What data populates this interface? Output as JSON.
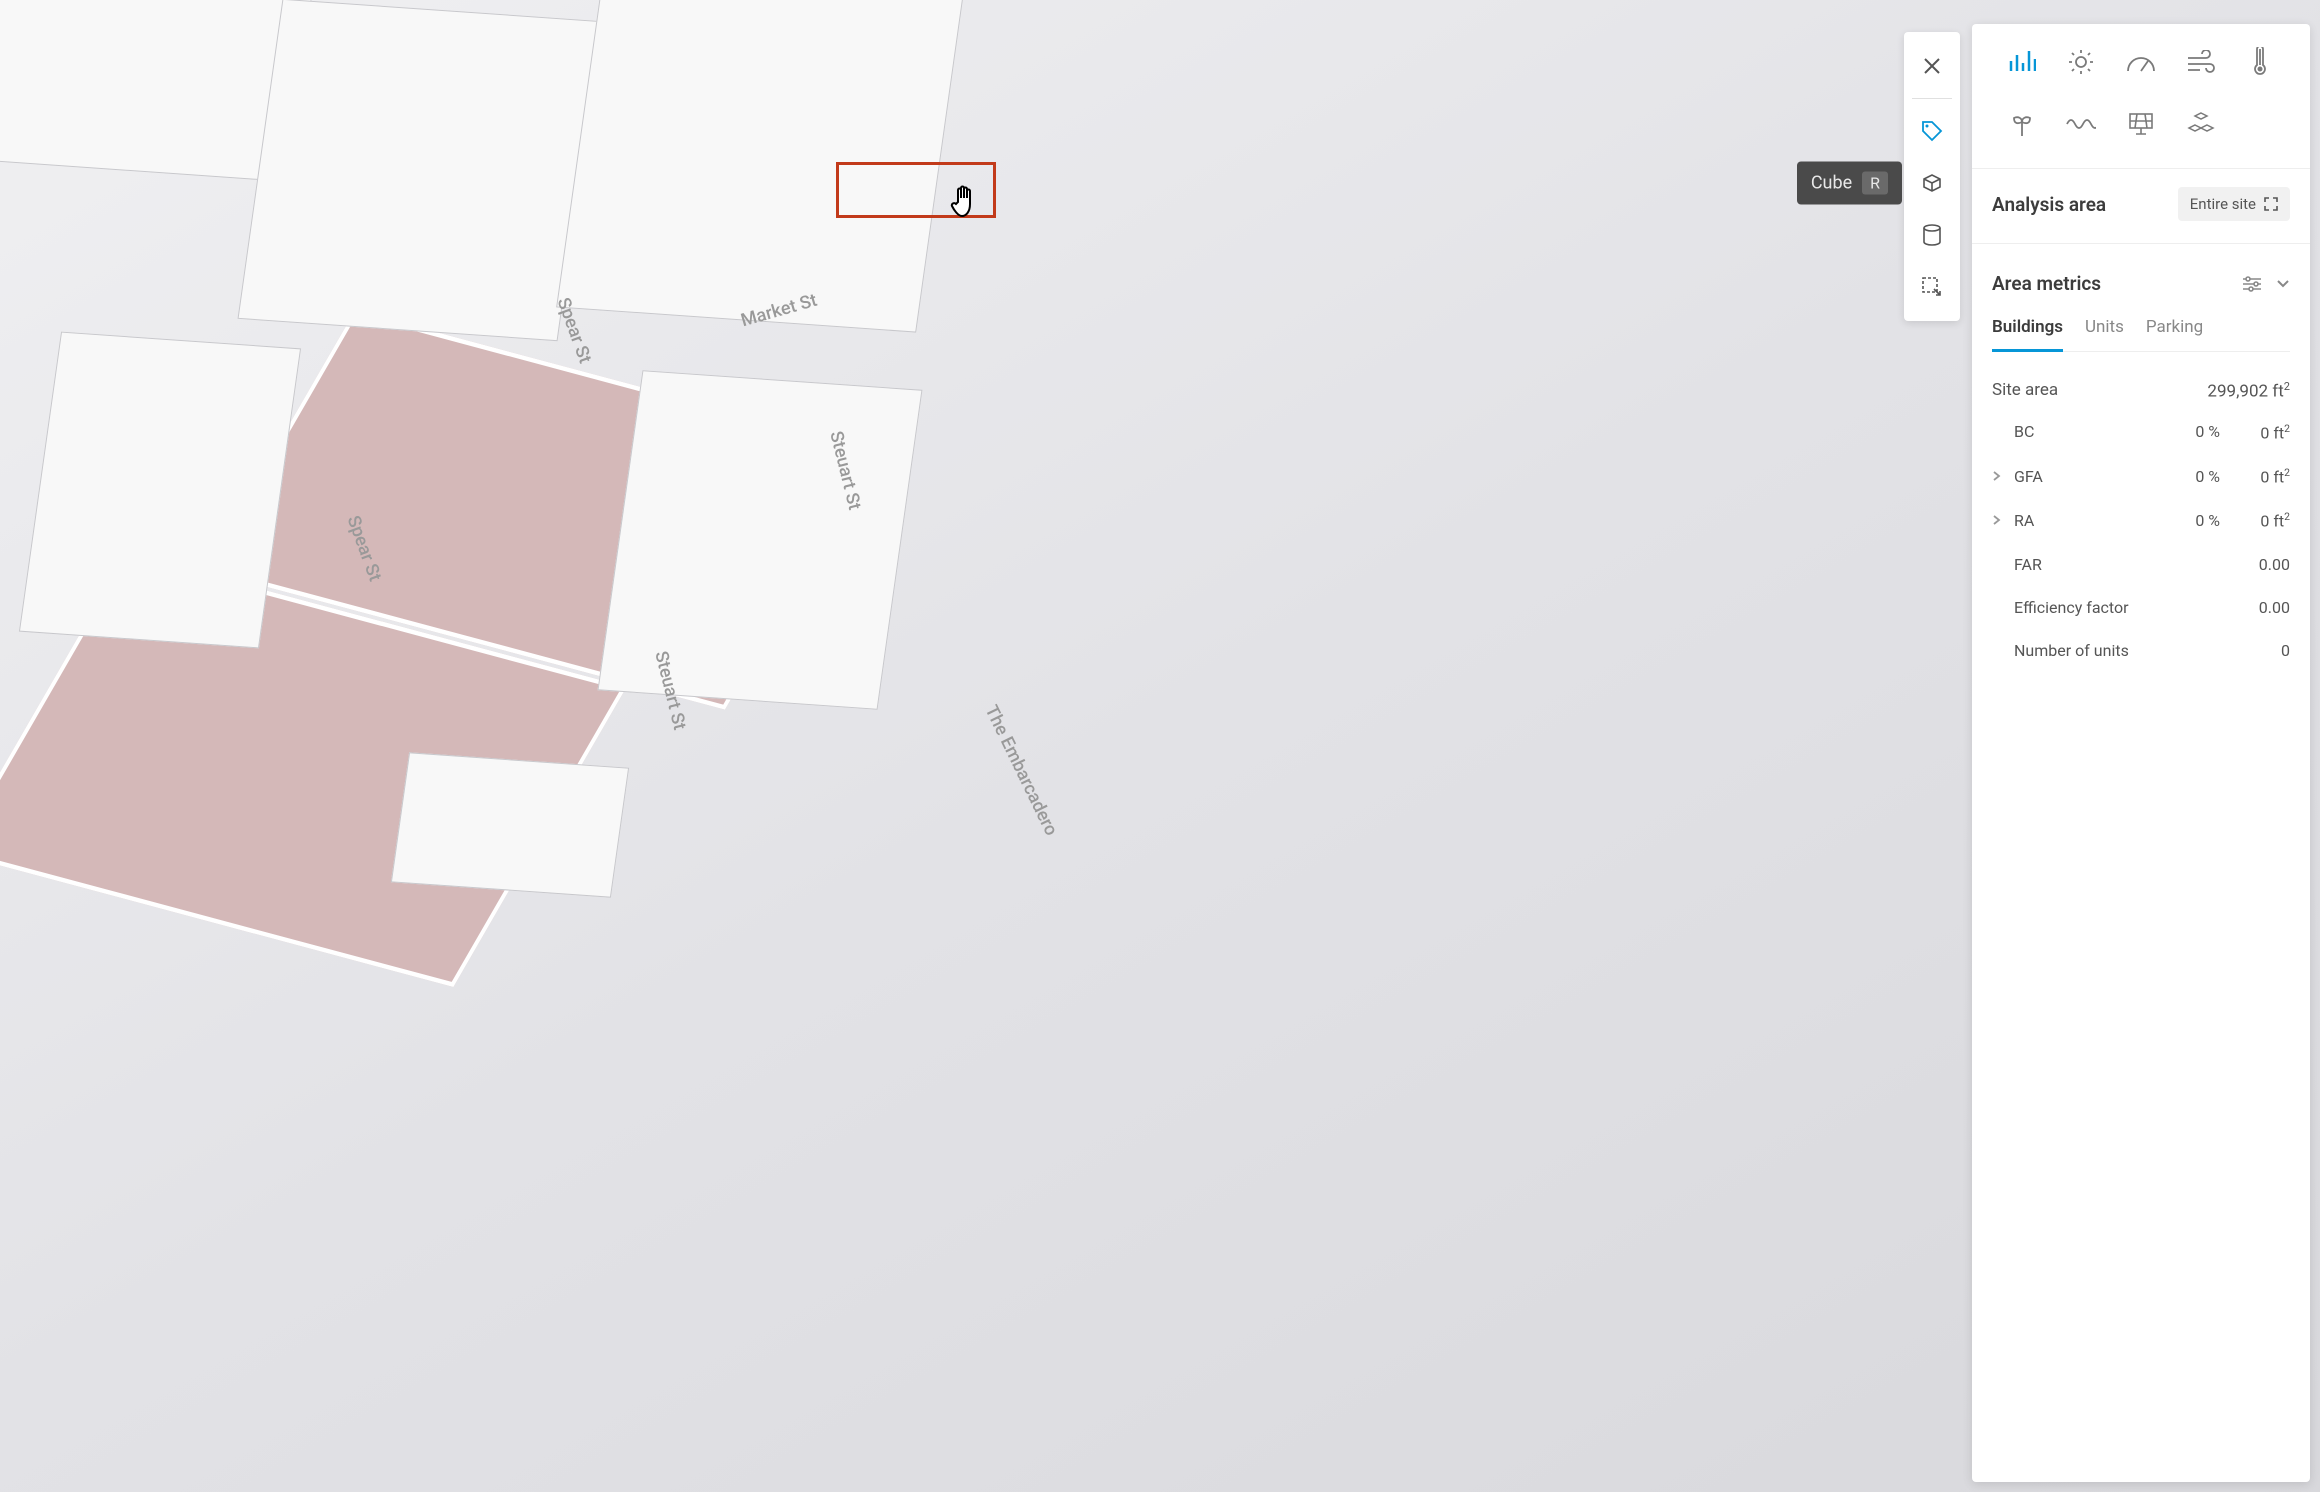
{
  "viewport": {
    "streets": [
      "Spear St",
      "Market St",
      "Steuart St",
      "Spear St",
      "Steuart St",
      "The Embarcadero"
    ]
  },
  "toolbar": {
    "tooltip_label": "Cube",
    "tooltip_shortcut": "R"
  },
  "panel": {
    "analysis_area_label": "Analysis area",
    "scope_label": "Entire site",
    "area_metrics_label": "Area metrics",
    "tabs": {
      "buildings": "Buildings",
      "units": "Units",
      "parking": "Parking"
    },
    "site_area": {
      "label": "Site area",
      "value": "299,902 ft²"
    },
    "rows": [
      {
        "key": "BC",
        "pct": "0 %",
        "val": "0 ft²",
        "expandable": false
      },
      {
        "key": "GFA",
        "pct": "0 %",
        "val": "0 ft²",
        "expandable": true
      },
      {
        "key": "RA",
        "pct": "0 %",
        "val": "0 ft²",
        "expandable": true
      }
    ],
    "simple_rows": [
      {
        "key": "FAR",
        "val": "0.00"
      },
      {
        "key": "Efficiency factor",
        "val": "0.00"
      },
      {
        "key": "Number of units",
        "val": "0"
      }
    ]
  }
}
